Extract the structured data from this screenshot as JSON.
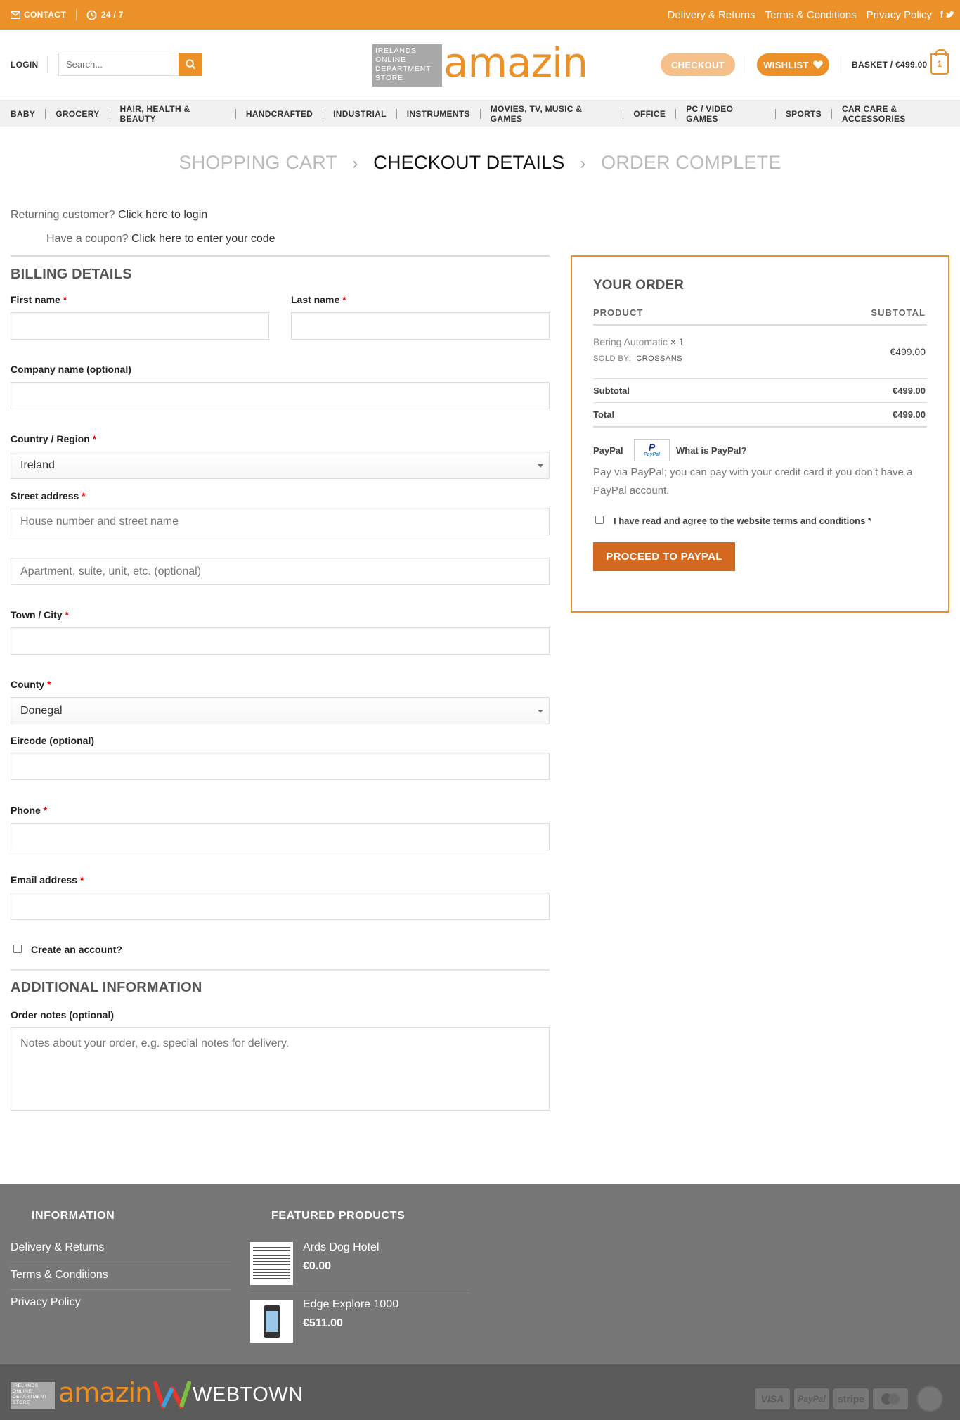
{
  "topbar": {
    "contact": "CONTACT",
    "hours": "24 / 7",
    "links": [
      "Delivery & Returns",
      "Terms & Conditions",
      "Privacy Policy"
    ],
    "social": [
      "facebook-icon",
      "twitter-icon"
    ],
    "color": "#ec9128"
  },
  "header": {
    "login": "LOGIN",
    "search_placeholder": "Search...",
    "logo_tag": "IRELANDS ONLINE DEPARTMENT STORE",
    "logo_word": "amazin",
    "checkout": "CHECKOUT",
    "wishlist": "WISHLIST",
    "basket": "BASKET / €499.00",
    "basket_count": "1"
  },
  "nav": [
    "BABY",
    "GROCERY",
    "HAIR, HEALTH & BEAUTY",
    "HANDCRAFTED",
    "INDUSTRIAL",
    "INSTRUMENTS",
    "MOVIES, TV, MUSIC & GAMES",
    "OFFICE",
    "PC / VIDEO GAMES",
    "SPORTS",
    "CAR CARE & ACCESSORIES"
  ],
  "steps": {
    "cart": "SHOPPING CART",
    "details": "CHECKOUT DETAILS",
    "complete": "ORDER COMPLETE"
  },
  "notices": {
    "returning_prefix": "Returning customer?",
    "returning_link": "Click here to login",
    "coupon_prefix": "Have a coupon?",
    "coupon_link": "Click here to enter your code"
  },
  "billing": {
    "title": "BILLING DETAILS",
    "first_name": "First name",
    "last_name": "Last name",
    "company": "Company name (optional)",
    "country": "Country / Region",
    "country_value": "Ireland",
    "street": "Street address",
    "street_placeholder": "House number and street name",
    "apt_placeholder": "Apartment, suite, unit, etc. (optional)",
    "town": "Town / City",
    "county": "County",
    "county_value": "Donegal",
    "eircode": "Eircode (optional)",
    "phone": "Phone",
    "email": "Email address",
    "create_account": "Create an account?",
    "required_mark": "*"
  },
  "additional": {
    "title": "ADDITIONAL INFORMATION",
    "notes_label": "Order notes (optional)",
    "notes_placeholder": "Notes about your order, e.g. special notes for delivery."
  },
  "order": {
    "title": "YOUR ORDER",
    "col_product": "PRODUCT",
    "col_subtotal": "SUBTOTAL",
    "item_name": "Bering Automatic",
    "item_qty": "× 1",
    "sold_by_label": "SOLD BY:",
    "sold_by": "CROSSANS",
    "item_price": "€499.00",
    "subtotal_label": "Subtotal",
    "subtotal": "€499.00",
    "total_label": "Total",
    "total": "€499.00",
    "paypal_label": "PayPal",
    "paypal_what": "What is PayPal?",
    "paypal_desc": "Pay via PayPal; you can pay with your credit card if you don’t have a PayPal account.",
    "terms": "I have read and agree to the website terms and conditions",
    "terms_req": "*",
    "proceed": "PROCEED TO PAYPAL"
  },
  "footer": {
    "info_title": "INFORMATION",
    "info_links": [
      "Delivery & Returns",
      "Terms & Conditions",
      "Privacy Policy"
    ],
    "featured_title": "FEATURED PRODUCTS",
    "products": [
      {
        "name": "Ards Dog Hotel",
        "price": "€0.00"
      },
      {
        "name": "Edge Explore 1000",
        "price": "€511.00"
      }
    ],
    "webtown": "WEBTOWN",
    "payments": [
      "VISA",
      "PayPal",
      "stripe",
      "mastercard",
      "CASH ON DELIVERY"
    ]
  }
}
